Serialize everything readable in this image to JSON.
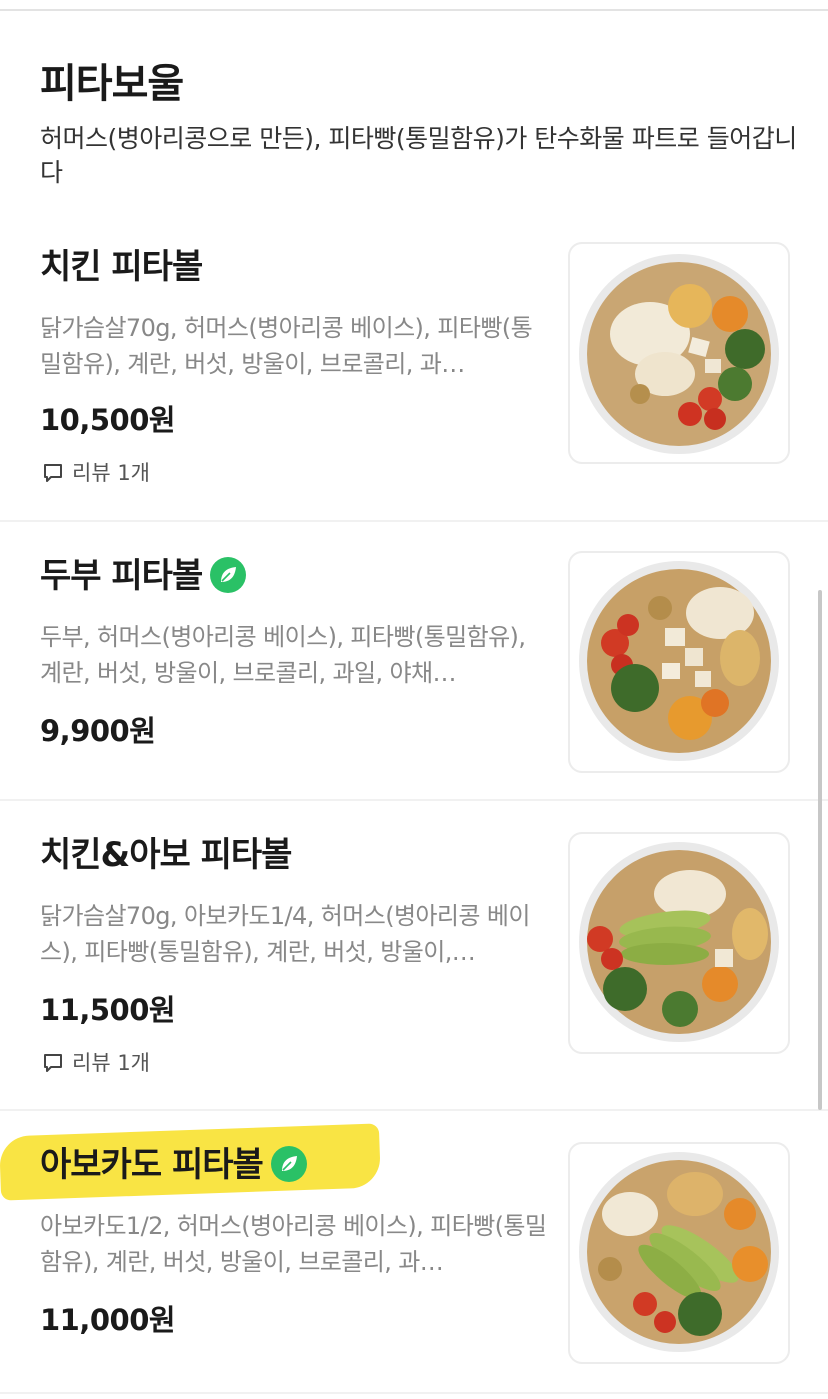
{
  "section": {
    "title": "피타보울",
    "description": "허머스(병아리콩으로 만든), 피타빵(통밀함유)가 탄수화물 파트로 들어갑니다"
  },
  "items": [
    {
      "name": "치킨 피타볼",
      "description": "닭가슴살70g, 허머스(병아리콩 베이스), 피타빵(통밀함유), 계란, 버섯, 방울이, 브로콜리, 과…",
      "price": "10,500원",
      "review": "리뷰 1개",
      "eco_badge": false
    },
    {
      "name": "두부 피타볼",
      "description": "두부, 허머스(병아리콩 베이스), 피타빵(통밀함유), 계란, 버섯, 방울이, 브로콜리, 과일, 야채…",
      "price": "9,900원",
      "review": "",
      "eco_badge": true
    },
    {
      "name": "치킨&아보 피타볼",
      "description": "닭가슴살70g, 아보카도1/4, 허머스(병아리콩 베이스), 피타빵(통밀함유), 계란, 버섯, 방울이,…",
      "price": "11,500원",
      "review": "리뷰 1개",
      "eco_badge": false
    },
    {
      "name": "아보카도 피타볼",
      "description": "아보카도1/2, 허머스(병아리콩 베이스), 피타빵(통밀함유), 계란, 버섯, 방울이, 브로콜리, 과…",
      "price": "11,000원",
      "review": "",
      "eco_badge": true
    }
  ],
  "colors": {
    "eco_badge": "#2ac166",
    "highlight": "#f9e33a"
  },
  "icons": {
    "review": "speech-bubble-icon",
    "eco": "leaf-icon"
  }
}
